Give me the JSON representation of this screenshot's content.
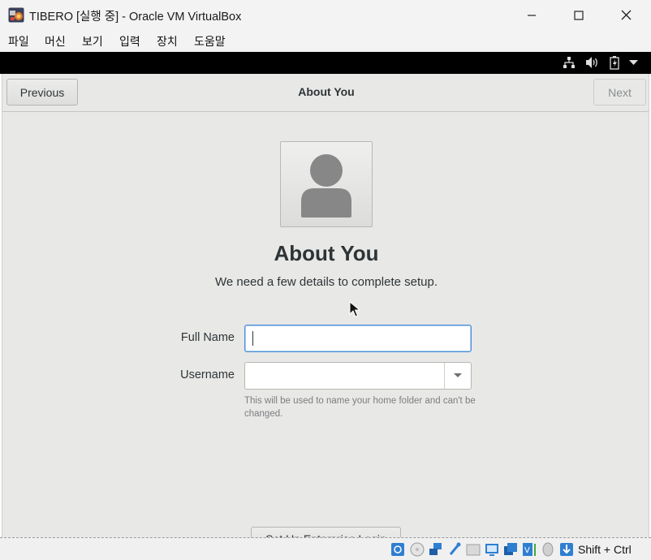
{
  "window": {
    "title": "TIBERO [실행 중] - Oracle VM VirtualBox",
    "controls": {
      "minimize": "minimize-icon",
      "maximize": "maximize-icon",
      "close": "close-icon"
    }
  },
  "menubar": {
    "items": [
      {
        "label": "파일"
      },
      {
        "label": "머신"
      },
      {
        "label": "보기"
      },
      {
        "label": "입력"
      },
      {
        "label": "장치"
      },
      {
        "label": "도움말"
      }
    ]
  },
  "vm_topbar": {
    "icons": [
      "network-icon",
      "volume-icon",
      "battery-icon",
      "chevron-down-icon"
    ]
  },
  "guest": {
    "header": {
      "previous_label": "Previous",
      "title": "About You",
      "next_label": "Next"
    },
    "avatar_icon": "user-avatar-icon",
    "heading": "About You",
    "subheading": "We need a few details to complete setup.",
    "form": {
      "full_name_label": "Full Name",
      "full_name_value": "",
      "username_label": "Username",
      "username_value": "",
      "hint": "This will be used to name your home folder and can't be changed."
    },
    "enterprise_login_label": "Set Up Enterprise Login"
  },
  "statusbar": {
    "icons": [
      "hard-disk-icon",
      "optical-drive-icon",
      "network-adapter-icon",
      "usb-icon",
      "shared-folders-icon",
      "display-icon",
      "video-capture-icon",
      "cpu-icon",
      "mouse-integration-icon",
      "keyboard-arrow-icon"
    ],
    "host_key": "Shift + Ctrl"
  },
  "colors": {
    "titlebar": "#f3f3f3",
    "vm_topbar": "#000000",
    "guest_bg": "#e8e8e7",
    "focus_accent": "#4a90d9"
  }
}
